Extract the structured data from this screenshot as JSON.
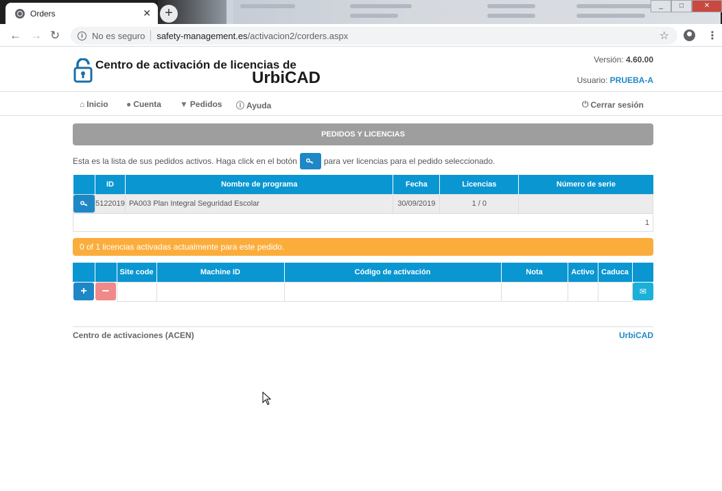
{
  "browser": {
    "tab_title": "Orders",
    "security_label": "No es seguro",
    "url_domain": "safety-management.es",
    "url_path": "/activacion2/corders.aspx"
  },
  "header": {
    "logo_line1": "Centro de activación de licencias de",
    "logo_line2": "UrbiCAD",
    "version_label": "Versión:",
    "version_value": "4.60.00",
    "user_label": "Usuario:",
    "user_value": "PRUEBA-A"
  },
  "nav": {
    "inicio": "Inicio",
    "cuenta": "Cuenta",
    "pedidos": "Pedidos",
    "ayuda": "Ayuda",
    "logout": "Cerrar sesión"
  },
  "section_title": "PEDIDOS Y LICENCIAS",
  "intro": {
    "before": "Esta es la lista de sus pedidos activos. Haga click en el botón",
    "after": "para ver licencias para el pedido seleccionado."
  },
  "orders_table": {
    "headers": [
      "",
      "ID",
      "Nombre de programa",
      "Fecha",
      "Licencias",
      "Número de serie"
    ],
    "row": {
      "id": "5122019",
      "program": "PA003 Plan Integral Seguridad Escolar",
      "date": "30/09/2019",
      "licenses": "1 / 0",
      "serial": ""
    },
    "page": "1"
  },
  "alert": "0 of 1 licencias activadas actualmente para este pedido.",
  "license_table": {
    "headers": [
      "",
      "",
      "Site code",
      "Machine ID",
      "Código de activación",
      "Nota",
      "Activo",
      "Caduca",
      ""
    ]
  },
  "footer": {
    "left": "Centro de activaciones (ACEN)",
    "right": "UrbiCAD"
  },
  "colors": {
    "primary": "#0a96d1",
    "button_blue": "#1e88c7",
    "alert_orange": "#fbad3c",
    "danger_soft": "#f08a8a"
  }
}
